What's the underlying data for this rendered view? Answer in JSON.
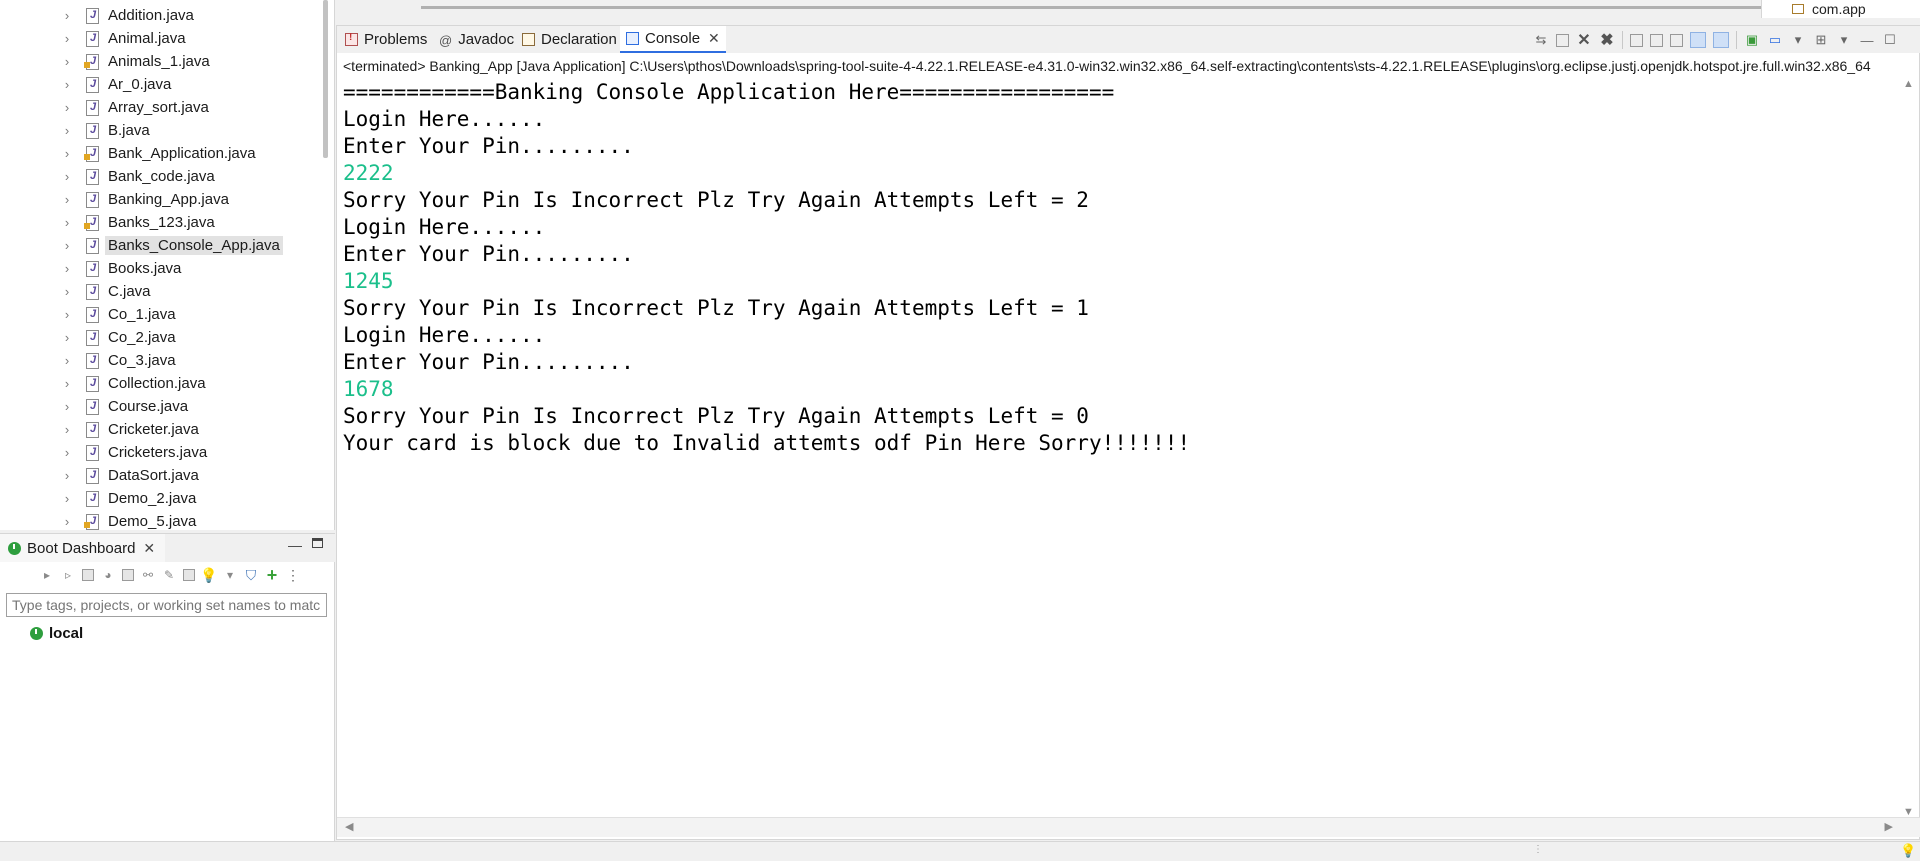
{
  "explorer": {
    "files": [
      {
        "name": "Addition.java",
        "warn": false
      },
      {
        "name": "Animal.java",
        "warn": false
      },
      {
        "name": "Animals_1.java",
        "warn": true
      },
      {
        "name": "Ar_0.java",
        "warn": false
      },
      {
        "name": "Array_sort.java",
        "warn": false
      },
      {
        "name": "B.java",
        "warn": false
      },
      {
        "name": "Bank_Application.java",
        "warn": true
      },
      {
        "name": "Bank_code.java",
        "warn": false
      },
      {
        "name": "Banking_App.java",
        "warn": false
      },
      {
        "name": "Banks_123.java",
        "warn": true
      },
      {
        "name": "Banks_Console_App.java",
        "warn": false,
        "selected": true
      },
      {
        "name": "Books.java",
        "warn": false
      },
      {
        "name": "C.java",
        "warn": false
      },
      {
        "name": "Co_1.java",
        "warn": false
      },
      {
        "name": "Co_2.java",
        "warn": false
      },
      {
        "name": "Co_3.java",
        "warn": false
      },
      {
        "name": "Collection.java",
        "warn": false
      },
      {
        "name": "Course.java",
        "warn": false
      },
      {
        "name": "Cricketer.java",
        "warn": false
      },
      {
        "name": "Cricketers.java",
        "warn": false
      },
      {
        "name": "DataSort.java",
        "warn": false
      },
      {
        "name": "Demo_2.java",
        "warn": false
      },
      {
        "name": "Demo_5.java",
        "warn": true
      }
    ]
  },
  "boot_dashboard": {
    "title": "Boot Dashboard",
    "search_placeholder": "Type tags, projects, or working set names to match",
    "local_label": "local"
  },
  "outline": {
    "item": "com.app"
  },
  "console": {
    "tabs": [
      {
        "label": "Problems",
        "icon": "problems-icon"
      },
      {
        "label": "Javadoc",
        "icon": "at-icon"
      },
      {
        "label": "Declaration",
        "icon": "declaration-icon"
      },
      {
        "label": "Console",
        "icon": "console-icon",
        "active": true
      }
    ],
    "terminated_text": "<terminated> Banking_App [Java Application] C:\\Users\\pthos\\Downloads\\spring-tool-suite-4-4.22.1.RELEASE-e4.31.0-win32.win32.x86_64.self-extracting\\contents\\sts-4.22.1.RELEASE\\plugins\\org.eclipse.justj.openjdk.hotspot.jre.full.win32.x86_64",
    "lines": [
      {
        "text": "============Banking Console Application Here=================",
        "input": false
      },
      {
        "text": "Login Here......",
        "input": false
      },
      {
        "text": "Enter Your Pin.........",
        "input": false
      },
      {
        "text": "2222",
        "input": true
      },
      {
        "text": "Sorry Your Pin Is Incorrect Plz Try Again Attempts Left = 2",
        "input": false
      },
      {
        "text": "Login Here......",
        "input": false
      },
      {
        "text": "Enter Your Pin.........",
        "input": false
      },
      {
        "text": "1245",
        "input": true
      },
      {
        "text": "Sorry Your Pin Is Incorrect Plz Try Again Attempts Left = 1",
        "input": false
      },
      {
        "text": "Login Here......",
        "input": false
      },
      {
        "text": "Enter Your Pin.........",
        "input": false
      },
      {
        "text": "1678",
        "input": true
      },
      {
        "text": "Sorry Your Pin Is Incorrect Plz Try Again Attempts Left = 0",
        "input": false
      },
      {
        "text": "Your card is block due to Invalid attemts odf Pin Here Sorry!!!!!!!",
        "input": false
      }
    ],
    "input_color": "#1bbf8b"
  }
}
